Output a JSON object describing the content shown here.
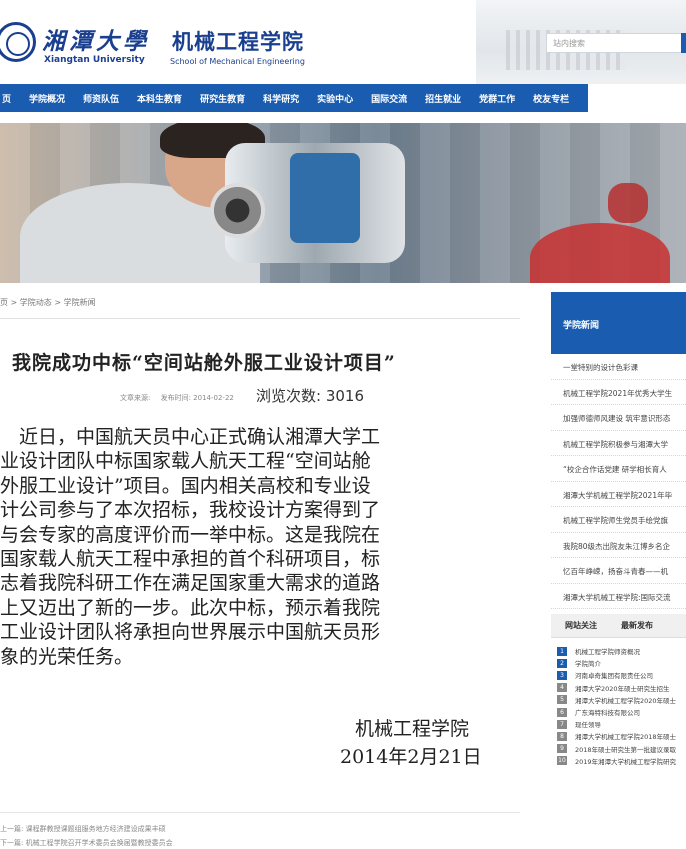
{
  "header": {
    "university_cn": "湘潭大學",
    "school_cn": "机械工程学院",
    "university_en": "Xiangtan University",
    "school_en": "School of Mechanical Engineering",
    "search_placeholder": "站内搜索"
  },
  "nav": {
    "items": [
      "页",
      "学院概况",
      "师资队伍",
      "本科生教育",
      "研究生教育",
      "科学研究",
      "实验中心",
      "国际交流",
      "招生就业",
      "党群工作",
      "校友专栏"
    ]
  },
  "breadcrumb": "页 > 学院动态 > 学院新闻",
  "article": {
    "title": "我院成功中标“空间站舱外服工业设计项目”",
    "source_label": "文章来源:",
    "date_label": "发布时间: 2014-02-22",
    "views": "浏览次数: 3016",
    "body_lines": [
      "　近日，中国航天员中心正式确认湘潭大学工",
      "业设计团队中标国家载人航天工程“空间站舱",
      "外服工业设计”项目。国内相关高校和专业设",
      "计公司参与了本次招标，我校设计方案得到了",
      "与会专家的高度评价而一举中标。这是我院在",
      "国家载人航天工程中承担的首个科研项目，标",
      "志着我院科研工作在满足国家重大需求的道路",
      "上又迈出了新的一步。此次中标，预示着我院",
      "工业设计团队将承担向世界展示中国航天员形",
      "象的光荣任务。"
    ],
    "signature_org": "机械工程学院",
    "signature_date": "2014年2月21日",
    "prev": "上一篇: 课程群教授课题组服务地方经济建设成果丰硕",
    "next": "下一篇: 机械工程学院召开学术委员会换届暨教授委员会"
  },
  "sidebar": {
    "title": "学院新闻",
    "items": [
      "一堂特别的设计色彩课",
      "机械工程学院2021年优秀大学生",
      "加强师德师风建设 筑牢意识形态",
      "机械工程学院积极参与湘潭大学",
      "“校企合作话党建 研学相长育人",
      "湘潭大学机械工程学院2021年毕",
      "机械工程学院师生党员手绘党旗",
      "我院80级杰出院友朱江博乡名企",
      "忆百年峥嵘，扬奋斗青春——机",
      "湘潭大学机械工程学院:国际交流"
    ],
    "tabs": [
      "网站关注",
      "最新发布"
    ],
    "ranked": [
      "机械工程学院师资概况",
      "学院简介",
      "河南卓奇集团有限责任公司",
      "湘潭大学2020年硕士研究生招生",
      "湘潭大学机械工程学院2020年硕士",
      "广东海特科技有限公司",
      "现任领导",
      "湘潭大学机械工程学院2018年硕士",
      "2018年硕士研究生第一批建议录取",
      "2019年湘潭大学机械工程学院研究"
    ]
  }
}
